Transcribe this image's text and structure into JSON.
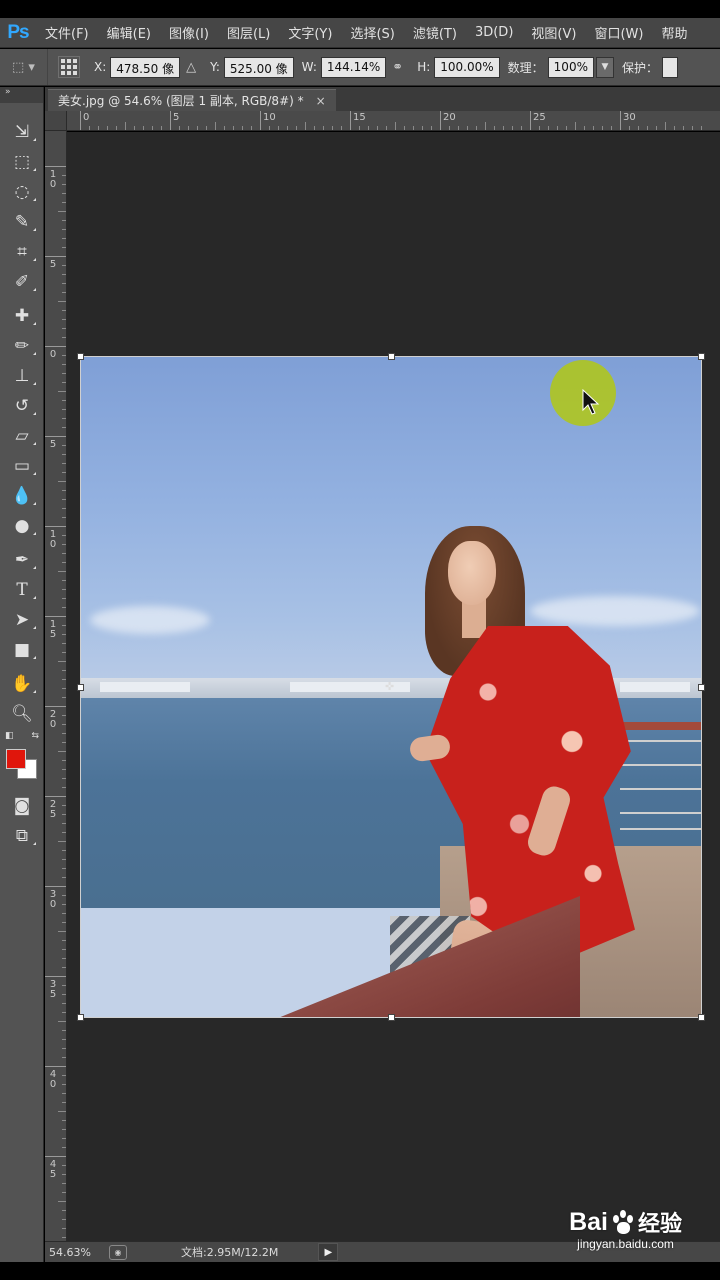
{
  "app": {
    "logo": "Ps"
  },
  "menu": [
    "文件(F)",
    "编辑(E)",
    "图像(I)",
    "图层(L)",
    "文字(Y)",
    "选择(S)",
    "滤镜(T)",
    "3D(D)",
    "视图(V)",
    "窗口(W)",
    "帮助"
  ],
  "options": {
    "x_label": "X:",
    "x_value": "478.50 像",
    "y_label": "Y:",
    "y_value": "525.00 像",
    "w_label": "W:",
    "w_value": "144.14%",
    "h_label": "H:",
    "h_value": "100.00%",
    "qty_label": "数理：",
    "qty_value": "100%",
    "protect_label": "保护："
  },
  "document": {
    "tab_title": "美女.jpg @ 54.6% (图层 1 副本, RGB/8#) *",
    "close": "×"
  },
  "ruler": {
    "h_labels": [
      "0",
      "5",
      "10",
      "15",
      "20",
      "25",
      "30"
    ],
    "v_labels": [
      "1\n0",
      "5",
      "0",
      "5",
      "1\n0",
      "1\n5",
      "2\n0",
      "2\n5",
      "3\n0",
      "3\n5",
      "4\n0",
      "4\n5"
    ]
  },
  "colors": {
    "foreground": "#e0160c",
    "background": "#ffffff",
    "accent": "#31a8ff",
    "cursor_highlight": "#b2c814"
  },
  "status": {
    "zoom": "54.63%",
    "doc_info": "文档:2.95M/12.2M",
    "arrow": "▶"
  },
  "watermark": {
    "brand_left": "Bai",
    "brand_right": "经验",
    "url": "jingyan.baidu.com"
  },
  "tools": [
    "move-tool-icon",
    "marquee-tool-icon",
    "lasso-tool-icon",
    "quick-select-tool-icon",
    "crop-tool-icon",
    "eyedropper-tool-icon",
    "healing-brush-tool-icon",
    "brush-tool-icon",
    "clone-stamp-tool-icon",
    "history-brush-tool-icon",
    "eraser-tool-icon",
    "gradient-tool-icon",
    "blur-tool-icon",
    "dodge-tool-icon",
    "pen-tool-icon",
    "type-tool-icon",
    "path-select-tool-icon",
    "rectangle-tool-icon",
    "hand-tool-icon",
    "zoom-tool-icon"
  ]
}
